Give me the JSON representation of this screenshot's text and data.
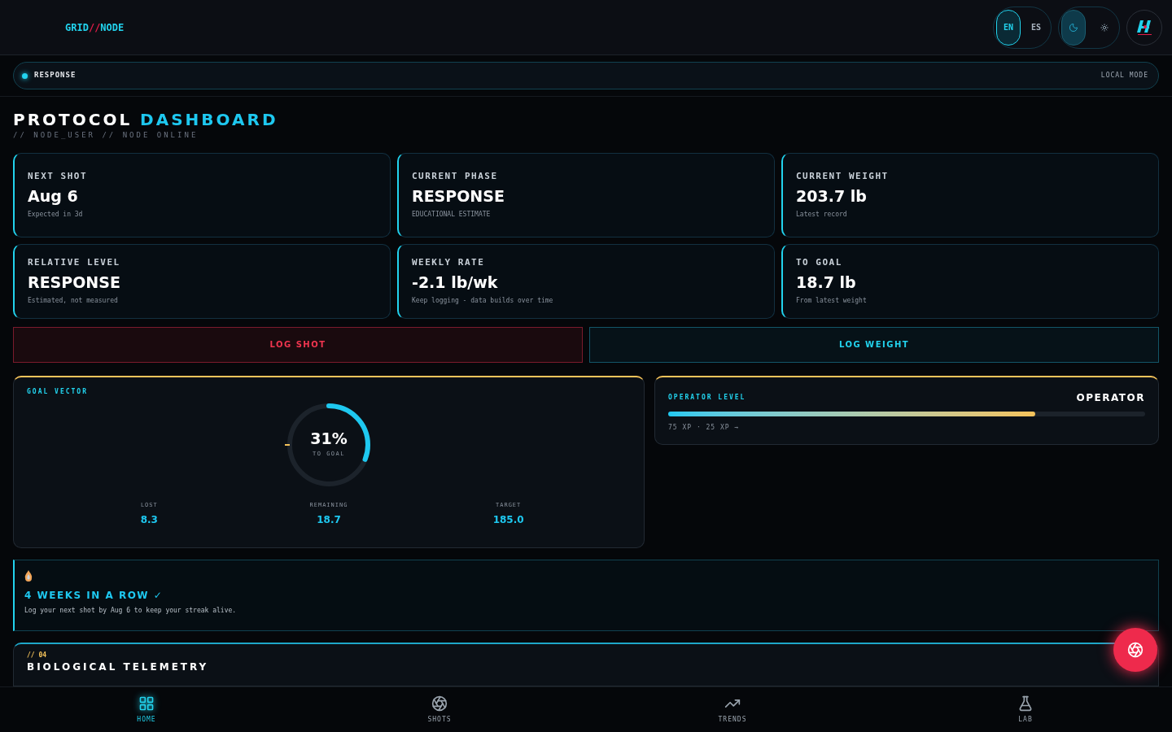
{
  "header": {
    "logo": [
      "GRID",
      "//",
      "NODE"
    ],
    "languages": [
      {
        "label": "EN",
        "selected": true
      },
      {
        "label": "ES",
        "selected": false
      }
    ],
    "themes": [
      {
        "kind": "moon",
        "selected": true
      },
      {
        "kind": "sun",
        "selected": false
      }
    ]
  },
  "status_banner": {
    "label": "RESPONSE",
    "mode": "LOCAL MODE"
  },
  "title": {
    "main": "PROTOCOL",
    "accent": "DASHBOARD",
    "subtitle": "// NODE_USER // NODE ONLINE"
  },
  "stat_cards": [
    {
      "label": "NEXT SHOT",
      "value": "Aug 6",
      "note": "Expected in 3d"
    },
    {
      "label": "CURRENT PHASE",
      "value": "RESPONSE",
      "note": "EDUCATIONAL ESTIMATE"
    },
    {
      "label": "CURRENT WEIGHT",
      "value": "203.7 lb",
      "note": "Latest record"
    },
    {
      "label": "RELATIVE LEVEL",
      "value": "RESPONSE",
      "note": "Estimated, not measured"
    },
    {
      "label": "WEEKLY RATE",
      "value": "-2.1 lb/wk",
      "note": "Keep logging - data builds over time"
    },
    {
      "label": "TO GOAL",
      "value": "18.7 lb",
      "note": "From latest weight"
    }
  ],
  "actions": [
    {
      "kind": "danger",
      "label": "LOG SHOT"
    },
    {
      "kind": "primary",
      "label": "LOG WEIGHT"
    }
  ],
  "goal_vector": {
    "title": "GOAL VECTOR",
    "percent": "31%",
    "caption": "TO GOAL",
    "level": 0.31,
    "stats": [
      {
        "label": "LOST",
        "value": "8.3"
      },
      {
        "label": "REMAINING",
        "value": "18.7"
      },
      {
        "label": "TARGET",
        "value": "185.0"
      }
    ]
  },
  "operator_level": {
    "title": "OPERATOR LEVEL",
    "rank": "OPERATOR",
    "level": 0.77,
    "xp": "75 XP · 25 XP →"
  },
  "streak": {
    "title": "4 WEEKS IN A ROW ✓",
    "message": "Log your next shot by Aug 6 to keep your streak alive."
  },
  "telemetry": {
    "index": "// 04",
    "title": "BIOLOGICAL TELEMETRY"
  },
  "nav": [
    {
      "kind": "home",
      "label": "HOME",
      "selected": true
    },
    {
      "kind": "shots",
      "label": "SHOTS",
      "selected": false
    },
    {
      "kind": "trends",
      "label": "TRENDS",
      "selected": false
    },
    {
      "kind": "lab",
      "label": "LAB",
      "selected": false
    }
  ]
}
